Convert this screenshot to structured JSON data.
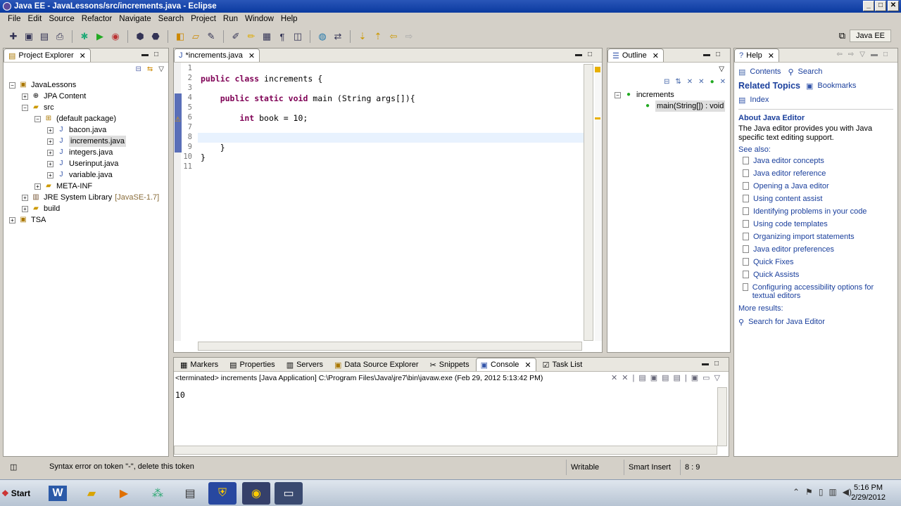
{
  "window": {
    "title": "Java EE - JavaLessons/src/increments.java - Eclipse"
  },
  "menu": [
    "File",
    "Edit",
    "Source",
    "Refactor",
    "Navigate",
    "Search",
    "Project",
    "Run",
    "Window",
    "Help"
  ],
  "perspective": {
    "label": "Java EE"
  },
  "project_explorer": {
    "tab": "Project Explorer",
    "items": [
      {
        "label": "JavaLessons",
        "suffix": ""
      },
      {
        "label": "JPA Content",
        "suffix": ""
      },
      {
        "label": "src",
        "suffix": ""
      },
      {
        "label": "(default package)",
        "suffix": ""
      },
      {
        "label": "bacon.java",
        "suffix": ""
      },
      {
        "label": "increments.java",
        "suffix": ""
      },
      {
        "label": "integers.java",
        "suffix": ""
      },
      {
        "label": "Userinput.java",
        "suffix": ""
      },
      {
        "label": "variable.java",
        "suffix": ""
      },
      {
        "label": "META-INF",
        "suffix": ""
      },
      {
        "label": "JRE System Library",
        "suffix": "[JavaSE-1.7]"
      },
      {
        "label": "build",
        "suffix": ""
      },
      {
        "label": "TSA",
        "suffix": ""
      }
    ]
  },
  "editor": {
    "tab": "*increments.java",
    "line_numbers": [
      "1",
      "2",
      "3",
      "4",
      "5",
      "6",
      "7",
      "8",
      "9",
      "10",
      "11"
    ],
    "lines": [
      "",
      "public class increments {",
      "",
      "    public static void main (String args[]){",
      "",
      "        int book = 10;",
      "",
      "",
      "    }",
      "}",
      ""
    ]
  },
  "outline": {
    "tab": "Outline",
    "class_name": "increments",
    "method": "main(String[]) : void"
  },
  "help": {
    "tab": "Help",
    "contents": "Contents",
    "search": "Search",
    "related_topics": "Related Topics",
    "bookmarks": "Bookmarks",
    "index": "Index",
    "about_title": "About Java Editor",
    "about_text": "The Java editor provides you with Java specific text editing support.",
    "see_also": "See also:",
    "links": [
      "Java editor concepts",
      "Java editor reference",
      "Opening a Java editor",
      "Using content assist",
      "Identifying problems in your code",
      "Using code templates",
      "Organizing import statements",
      "Java editor preferences",
      "Quick Fixes",
      "Quick Assists",
      "Configuring accessibility options for textual editors"
    ],
    "more_results": "More results:",
    "search_for": "Search for Java Editor"
  },
  "bottom_tabs": [
    "Markers",
    "Properties",
    "Servers",
    "Data Source Explorer",
    "Snippets",
    "Console",
    "Task List"
  ],
  "console": {
    "header": "<terminated> increments [Java Application] C:\\Program Files\\Java\\jre7\\bin\\javaw.exe (Feb 29, 2012 5:13:42 PM)",
    "output": "10"
  },
  "status": {
    "message": "Syntax error on token \"-\", delete this token",
    "writable": "Writable",
    "insert": "Smart Insert",
    "position": "8 : 9"
  },
  "taskbar": {
    "start": "Start",
    "time": "5:16 PM",
    "date": "2/29/2012"
  }
}
